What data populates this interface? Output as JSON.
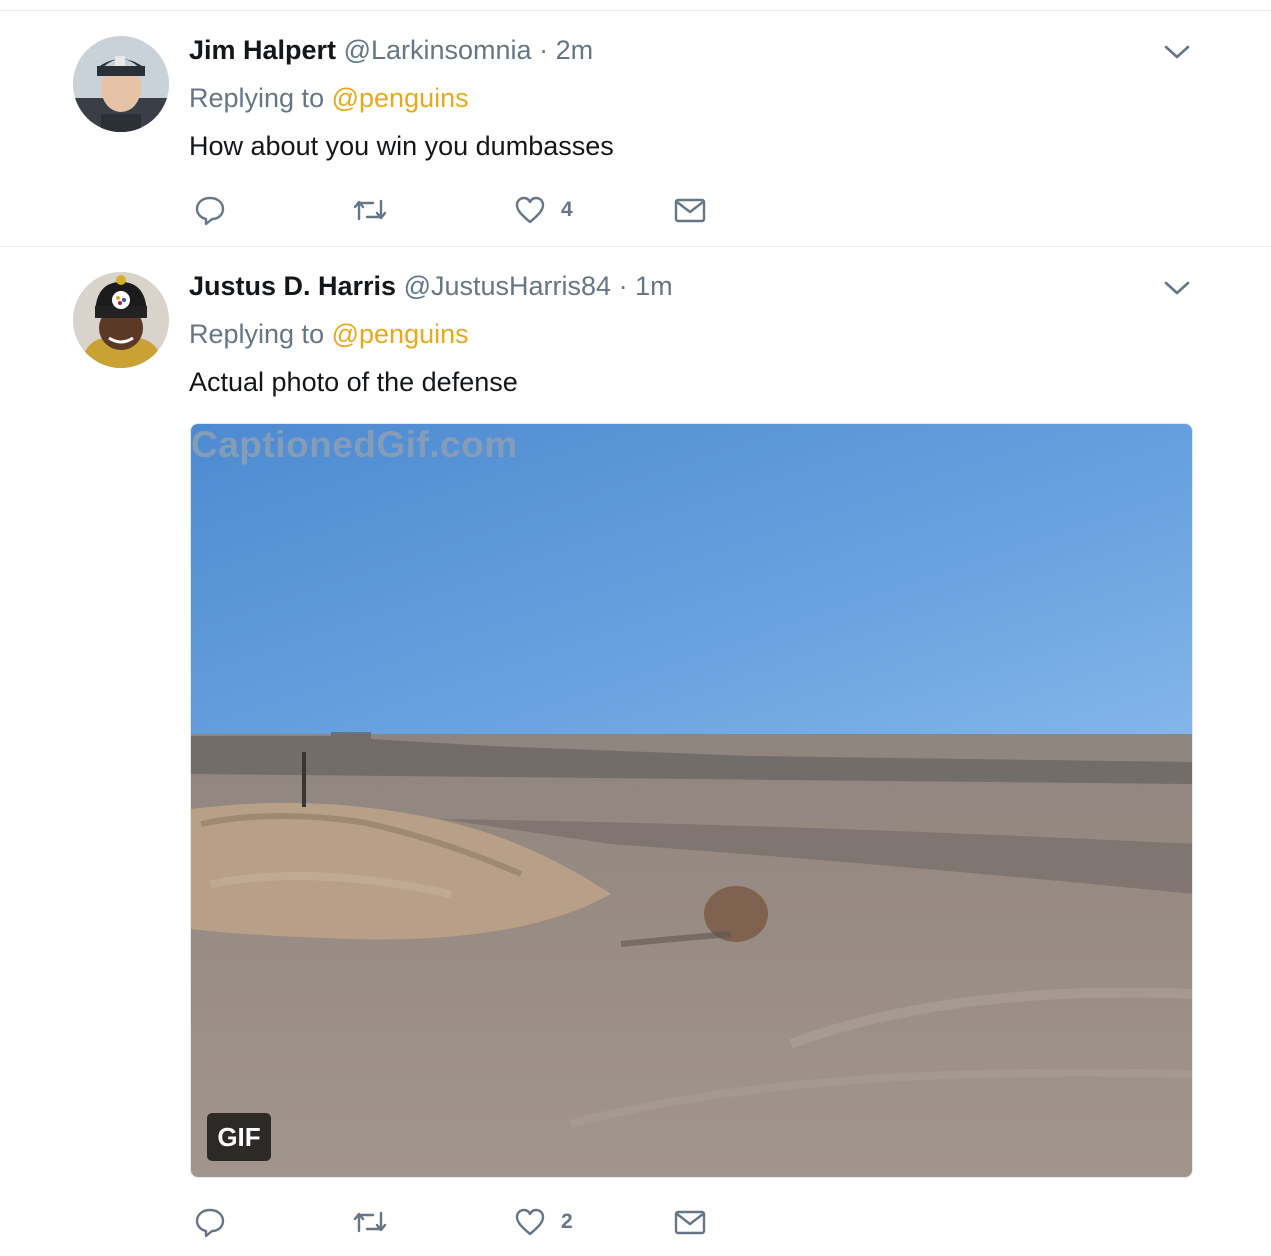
{
  "tweets": [
    {
      "name": "Jim Halpert",
      "handle": "@Larkinsomnia",
      "separator": "·",
      "time": "2m",
      "replying_prefix": "Replying to",
      "replying_mention": "@penguins",
      "text": "How about you win you dumbasses",
      "likes": "4",
      "replies": "",
      "retweets": ""
    },
    {
      "name": "Justus D. Harris",
      "handle": "@JustusHarris84",
      "separator": "·",
      "time": "1m",
      "replying_prefix": "Replying to",
      "replying_mention": "@penguins",
      "text": "Actual photo of the defense",
      "media": {
        "watermark": "CaptionedGif.com",
        "badge": "GIF"
      },
      "likes": "2",
      "replies": "",
      "retweets": ""
    }
  ],
  "colors": {
    "mention": "#e8a91c",
    "secondary_text": "#657786",
    "divider": "#e6ecf0",
    "icon": "#657786"
  },
  "icons": [
    "reply-icon",
    "retweet-icon",
    "heart-icon",
    "envelope-icon",
    "chevron-down-icon"
  ]
}
